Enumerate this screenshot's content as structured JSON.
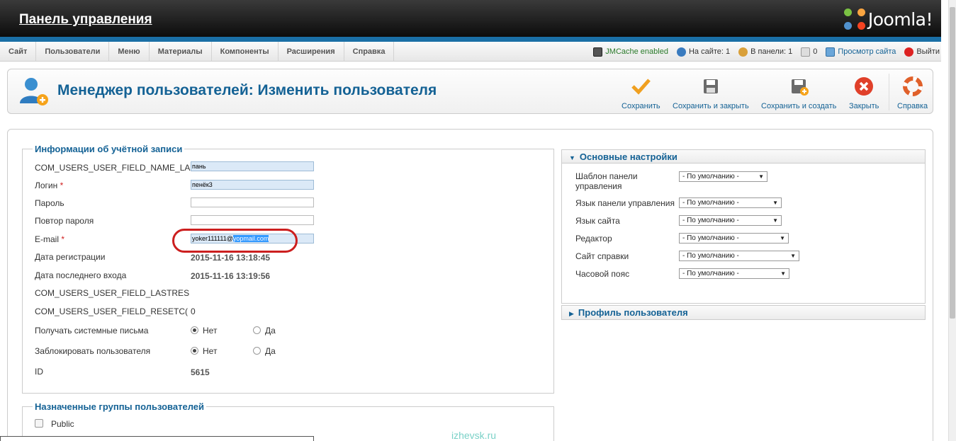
{
  "header": {
    "title": "Панель управления",
    "logo_text": "Joomla!"
  },
  "menu": [
    "Сайт",
    "Пользователи",
    "Меню",
    "Материалы",
    "Компоненты",
    "Расширения",
    "Справка"
  ],
  "status": {
    "jmcache": "JMCache enabled",
    "on_site": "На сайте: 1",
    "in_panel": "В панели: 1",
    "messages": "0",
    "view_site": "Просмотр сайта",
    "logout": "Выйти"
  },
  "toolbar": {
    "page_title": "Менеджер пользователей: Изменить пользователя",
    "save": "Сохранить",
    "save_close": "Сохранить и закрыть",
    "save_new": "Сохранить и создать",
    "close": "Закрыть",
    "help": "Справка"
  },
  "account": {
    "legend": "Информации об учётной записи",
    "name_label": "COM_USERS_USER_FIELD_NAME_LA",
    "name_value": "пань",
    "login_label": "Логин",
    "login_value": "пенёк3",
    "password_label": "Пароль",
    "password2_label": "Повтор пароля",
    "email_label": "E-mail",
    "email_user": "yoker111111@",
    "email_domain": "yopmail.com",
    "regdate_label": "Дата регистрации",
    "regdate_value": "2015-11-16 13:18:45",
    "lastvisit_label": "Дата последнего входа",
    "lastvisit_value": "2015-11-16 13:19:56",
    "lastreset_label": "COM_USERS_USER_FIELD_LASTRES",
    "resetcount_label": "COM_USERS_USER_FIELD_RESETC(",
    "resetcount_value": "0",
    "sendemail_label": "Получать системные письма",
    "block_label": "Заблокировать пользователя",
    "no": "Нет",
    "yes": "Да",
    "id_label": "ID",
    "id_value": "5615",
    "required_mark": "*"
  },
  "groups": {
    "legend": "Назначенные группы пользователей",
    "items": [
      "Public"
    ]
  },
  "basic": {
    "title": "Основные настройки",
    "admin_template_label": "Шаблон панели управления",
    "admin_lang_label": "Язык панели управления",
    "site_lang_label": "Язык сайта",
    "editor_label": "Редактор",
    "help_site_label": "Сайт справки",
    "timezone_label": "Часовой пояс",
    "default_option": "- По умолчанию -"
  },
  "profile": {
    "title": "Профиль пользователя"
  },
  "watermark": "izhevsk.ru",
  "colors": {
    "accent": "#146295",
    "header_dark": "#0c0c0c",
    "strip": "#1a6fa6",
    "highlight": "#cc1f1f"
  }
}
